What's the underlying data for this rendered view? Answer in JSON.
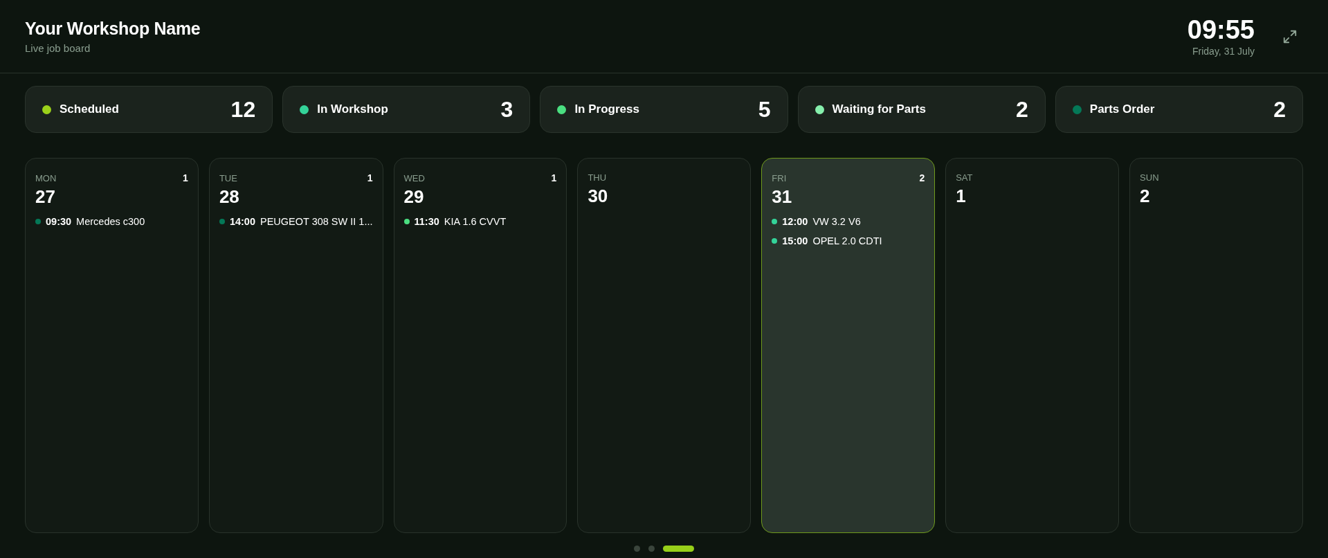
{
  "header": {
    "title": "Your Workshop Name",
    "subtitle": "Live job board",
    "time": "09:55",
    "date": "Friday, 31 July"
  },
  "stats": [
    {
      "label": "Scheduled",
      "count": "12",
      "color": "#9bd11a"
    },
    {
      "label": "In Workshop",
      "count": "3",
      "color": "#34d399"
    },
    {
      "label": "In Progress",
      "count": "5",
      "color": "#4ade80"
    },
    {
      "label": "Waiting for Parts",
      "count": "2",
      "color": "#86efac"
    },
    {
      "label": "Parts Order",
      "count": "2",
      "color": "#047857"
    }
  ],
  "days": [
    {
      "weekday": "MON",
      "date": "27",
      "count": "1",
      "selected": false,
      "jobs": [
        {
          "time": "09:30",
          "vehicle": "Mercedes c300",
          "color": "#047857"
        }
      ]
    },
    {
      "weekday": "TUE",
      "date": "28",
      "count": "1",
      "selected": false,
      "jobs": [
        {
          "time": "14:00",
          "vehicle": "PEUGEOT 308 SW II 1...",
          "color": "#047857"
        }
      ]
    },
    {
      "weekday": "WED",
      "date": "29",
      "count": "1",
      "selected": false,
      "jobs": [
        {
          "time": "11:30",
          "vehicle": "KIA 1.6 CVVT",
          "color": "#4ade80"
        }
      ]
    },
    {
      "weekday": "THU",
      "date": "30",
      "selected": false
    },
    {
      "weekday": "FRI",
      "date": "31",
      "count": "2",
      "selected": true,
      "jobs": [
        {
          "time": "12:00",
          "vehicle": "VW 3.2 V6",
          "color": "#34d399"
        },
        {
          "time": "15:00",
          "vehicle": "OPEL 2.0 CDTI",
          "color": "#34d399"
        }
      ]
    },
    {
      "weekday": "SAT",
      "date": "1",
      "selected": false
    },
    {
      "weekday": "SUN",
      "date": "2",
      "selected": false
    }
  ],
  "pages": [
    {
      "selected": false
    },
    {
      "selected": false
    },
    {
      "selected": true
    }
  ]
}
